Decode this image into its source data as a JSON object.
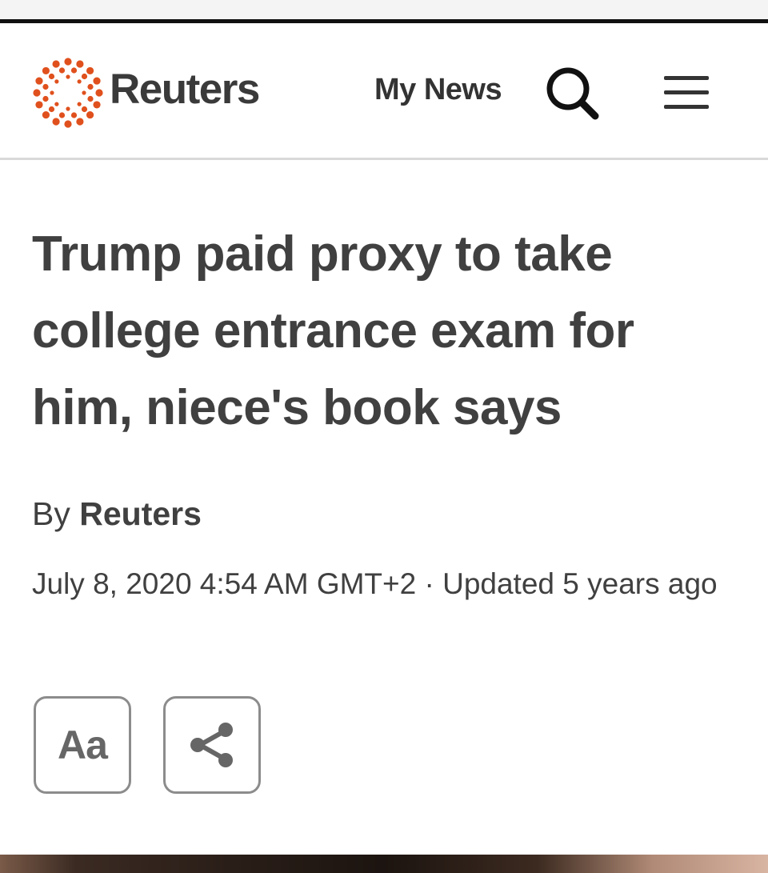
{
  "header": {
    "brand": "Reuters",
    "my_news": "My News",
    "icons": {
      "logo": "reuters-dot-ring-logo",
      "search": "magnifier-icon",
      "menu": "hamburger-icon"
    },
    "colors": {
      "logo_orange": "#e0501d",
      "text_dark": "#3a3a3a"
    }
  },
  "article": {
    "headline": "Trump paid proxy to take college entrance exam for him, niece's book says",
    "byline_prefix": "By",
    "byline_author": "Reuters",
    "dateline": "July 8, 2020 4:54 AM GMT+2 · Updated 5 years ago"
  },
  "tools": {
    "font_size_label": "Aa",
    "share_icon": "share-icon"
  }
}
